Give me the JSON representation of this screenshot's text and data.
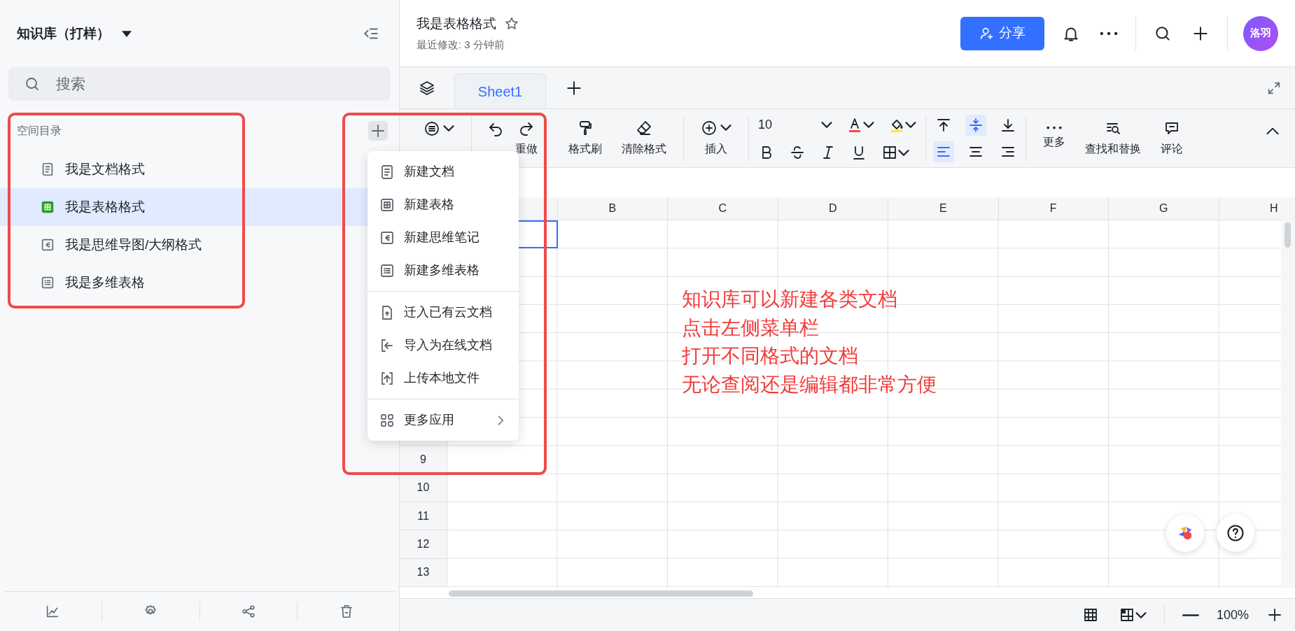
{
  "sidebar": {
    "title": "知识库（打样）",
    "search": {
      "placeholder": "搜索"
    },
    "section_label": "空间目录",
    "items": [
      {
        "label": "我是文档格式",
        "kind": "doc",
        "selected": false
      },
      {
        "label": "我是表格格式",
        "kind": "sheet",
        "selected": true
      },
      {
        "label": "我是思维导图/大纲格式",
        "kind": "mindmap",
        "selected": false
      },
      {
        "label": "我是多维表格",
        "kind": "base",
        "selected": false
      }
    ]
  },
  "document": {
    "title": "我是表格格式",
    "subtitle": "最近修改: 3 分钟前",
    "share": "分享",
    "avatar": "洛羽"
  },
  "sheet_tabs": [
    {
      "label": "Sheet1",
      "selected": true
    }
  ],
  "toolbar": {
    "redo": "重做",
    "painter": "格式刷",
    "clear": "清除格式",
    "insert": "插入",
    "font_size": "10",
    "more": "更多",
    "find": "查找和替换",
    "comment": "评论",
    "vertical_align": [
      {
        "kind": "top",
        "selected": false
      },
      {
        "kind": "middle",
        "selected": true
      },
      {
        "kind": "bottom",
        "selected": false
      }
    ],
    "horizontal_align": [
      {
        "kind": "left",
        "selected": true
      },
      {
        "kind": "center",
        "selected": false
      },
      {
        "kind": "right",
        "selected": false
      }
    ]
  },
  "grid": {
    "columns": [
      "B",
      "C",
      "D",
      "E",
      "F",
      "G",
      "H"
    ],
    "row_labels": [
      "9",
      "10",
      "11",
      "12",
      "13"
    ]
  },
  "menu": {
    "sections": [
      {
        "items": [
          {
            "label": "新建文档",
            "kind": "doc"
          },
          {
            "label": "新建表格",
            "kind": "sheet"
          },
          {
            "label": "新建思维笔记",
            "kind": "mindmap"
          },
          {
            "label": "新建多维表格",
            "kind": "base"
          }
        ]
      },
      {
        "items": [
          {
            "label": "迁入已有云文档",
            "kind": "migrate"
          },
          {
            "label": "导入为在线文档",
            "kind": "import"
          },
          {
            "label": "上传本地文件",
            "kind": "upload"
          }
        ]
      },
      {
        "items": [
          {
            "label": "更多应用",
            "kind": "apps",
            "submenu": true
          }
        ]
      }
    ]
  },
  "annotation": {
    "lines": [
      "知识库可以新建各类文档",
      "点击左侧菜单栏",
      "打开不同格式的文档",
      "无论查阅还是编辑都非常方便"
    ]
  },
  "status_bar": {
    "zoom": "100%"
  }
}
